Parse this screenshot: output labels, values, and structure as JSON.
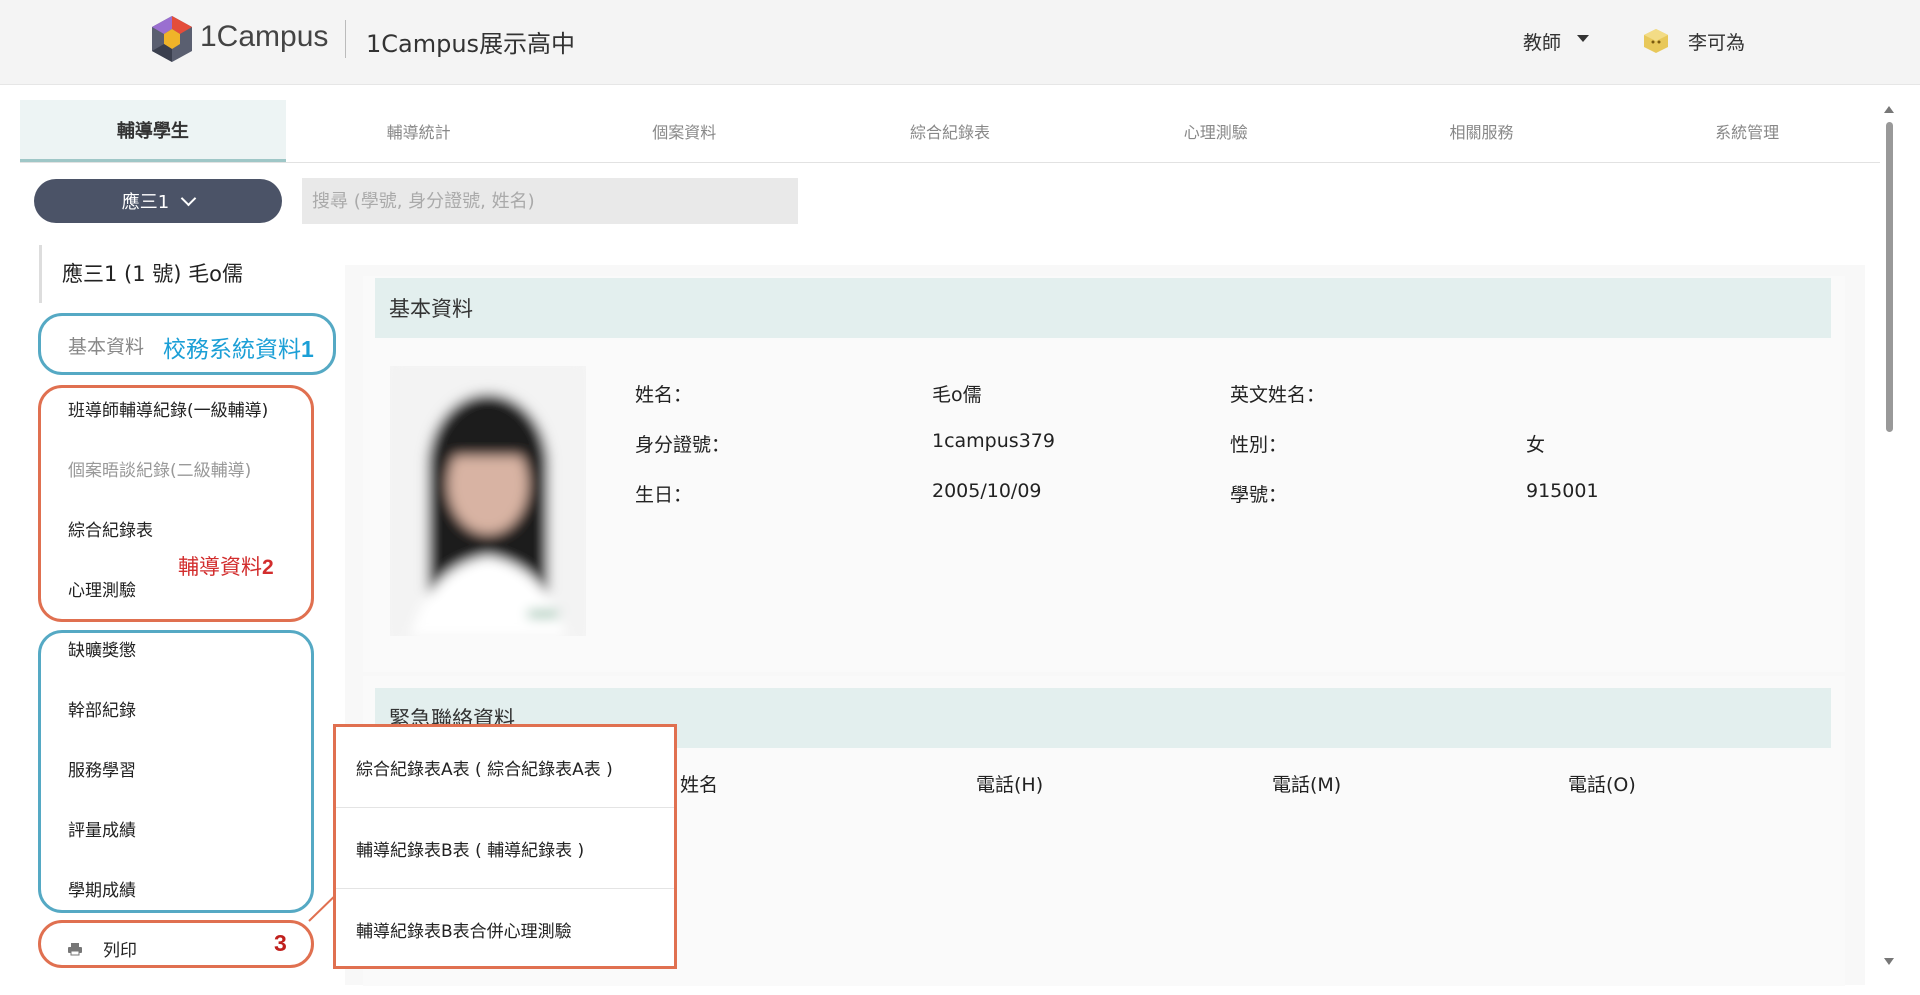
{
  "header": {
    "logo_text": "1Campus",
    "school_name": "1Campus展示高中",
    "role": "教師",
    "user_name": "李可為"
  },
  "tabs": [
    {
      "label": "輔導學生",
      "active": true
    },
    {
      "label": "輔導統計",
      "active": false
    },
    {
      "label": "個案資料",
      "active": false
    },
    {
      "label": "綜合紀錄表",
      "active": false
    },
    {
      "label": "心理測驗",
      "active": false
    },
    {
      "label": "相關服務",
      "active": false
    },
    {
      "label": "系統管理",
      "active": false
    }
  ],
  "class_select": {
    "value": "應三1"
  },
  "search": {
    "placeholder": "搜尋 (學號, 身分證號, 姓名)"
  },
  "student": {
    "header": "應三1 (1 號)  毛o儒"
  },
  "sidebar": {
    "basic": "基本資料",
    "annot_school_text": "校務系統資料",
    "annot_school_num": "1",
    "counsel_items": [
      {
        "label": "班導師輔導紀錄(一級輔導)",
        "muted": false
      },
      {
        "label": "個案晤談紀錄(二級輔導)",
        "muted": true
      },
      {
        "label": "綜合紀錄表",
        "muted": false
      },
      {
        "label": "心理測驗",
        "muted": false
      }
    ],
    "annot_counsel_text": "輔導資料",
    "annot_counsel_num": "2",
    "school_items": [
      {
        "label": "缺曠獎懲"
      },
      {
        "label": "幹部紀錄"
      },
      {
        "label": "服務學習"
      },
      {
        "label": "評量成績"
      },
      {
        "label": "學期成績"
      }
    ],
    "print_label": "列印",
    "annot_print_num": "3"
  },
  "basic_info": {
    "title": "基本資料",
    "name_label": "姓名：",
    "name_value": "毛o儒",
    "eng_name_label": "英文姓名：",
    "eng_name_value": "",
    "id_label": "身分證號：",
    "id_value": "1campus379",
    "gender_label": "性別：",
    "gender_value": "女",
    "birth_label": "生日：",
    "birth_value": "2005/10/09",
    "student_no_label": "學號：",
    "student_no_value": "915001"
  },
  "emergency": {
    "title": "緊急聯絡資料",
    "columns": [
      "姓名",
      "電話(H)",
      "電話(M)",
      "電話(O)"
    ]
  },
  "print_menu": [
    {
      "label": "綜合紀錄表A表 ( 綜合紀錄表A表 )"
    },
    {
      "label": "輔導紀錄表B表 ( 輔導紀錄表 )"
    },
    {
      "label": "輔導紀錄表B表合併心理測驗"
    }
  ],
  "colors": {
    "annot_blue": "#55a9c4",
    "annot_red": "#e07050",
    "select_bg": "#4b5367",
    "section_bg": "#e3efee"
  }
}
